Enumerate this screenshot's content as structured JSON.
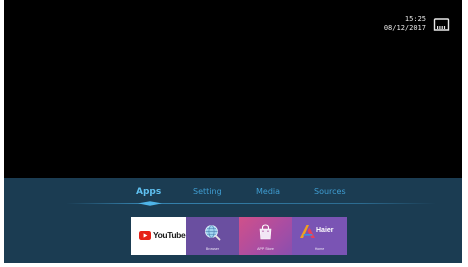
{
  "status": {
    "time": "15:25",
    "date": "08/12/2017",
    "network_icon": "ethernet-icon"
  },
  "launcher": {
    "tabs": [
      {
        "label": "Apps",
        "active": true
      },
      {
        "label": "Setting",
        "active": false
      },
      {
        "label": "Media",
        "active": false
      },
      {
        "label": "Sources",
        "active": false
      }
    ],
    "apps": [
      {
        "icon": "youtube-logo-icon",
        "label": "YouTube"
      },
      {
        "icon": "browser-globe-icon",
        "label": "Browser"
      },
      {
        "icon": "shopping-bag-icon",
        "label": "APP Store"
      },
      {
        "icon": "haier-logo-icon",
        "brand": "Haier",
        "label": "Home"
      }
    ]
  },
  "colors": {
    "screen_bg": "#000000",
    "launcher_bg": "#1b3c52",
    "tab_text": "#3f9ed3",
    "tab_active": "#5fc0f0",
    "youtube_red": "#e62117",
    "browser_tile": "#6a4fa0",
    "appstore_tile": "#c0509a",
    "haier_tile": "#7a54b4"
  }
}
